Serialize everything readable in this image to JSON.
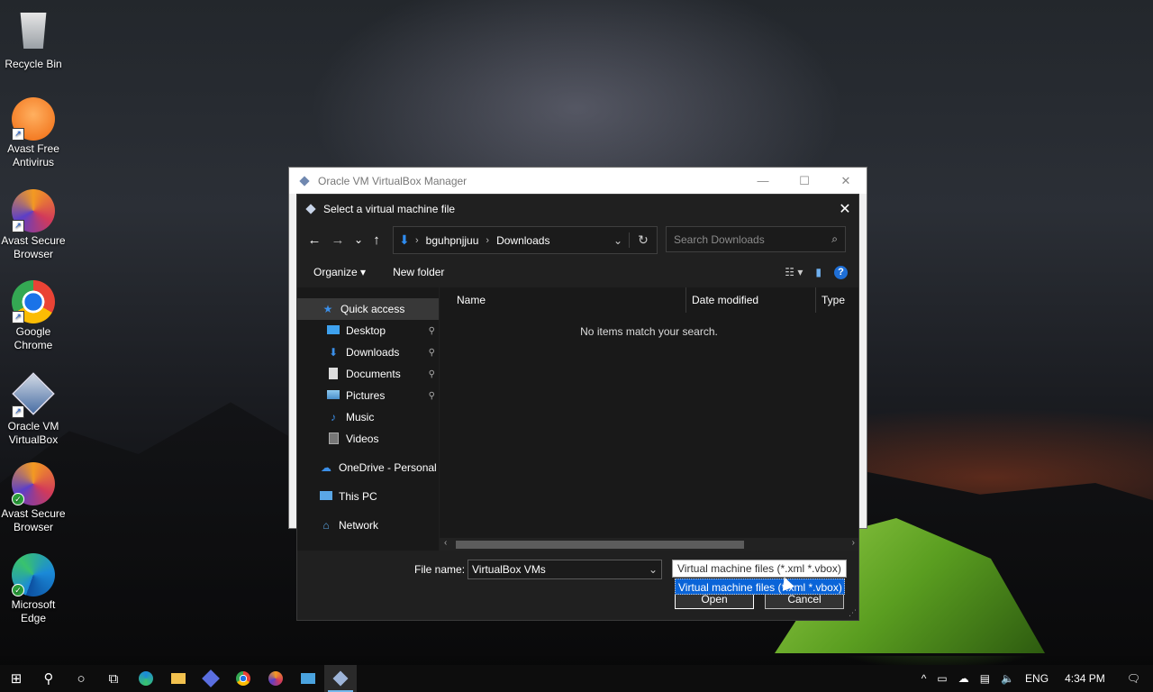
{
  "desktop": {
    "icons": [
      {
        "label": "Recycle Bin"
      },
      {
        "label": "Avast Free Antivirus"
      },
      {
        "label": "Avast Secure Browser"
      },
      {
        "label": "Google Chrome"
      },
      {
        "label": "Oracle VM VirtualBox"
      },
      {
        "label": "Avast Secure Browser"
      },
      {
        "label": "Microsoft Edge"
      }
    ]
  },
  "background_window": {
    "title": "Oracle VM VirtualBox Manager",
    "minimize": "—",
    "maximize": "☐",
    "close": "✕"
  },
  "dialog": {
    "title": "Select a virtual machine file",
    "close": "✕",
    "nav": {
      "back": "←",
      "forward": "→",
      "recent": "⌄",
      "up": "↑",
      "breadcrumb": [
        "bguhpnjjuu",
        "Downloads"
      ],
      "breadcrumb_sep": "›",
      "address_dropdown": "⌄",
      "refresh": "↻"
    },
    "search": {
      "placeholder": "Search Downloads",
      "icon": "⌕"
    },
    "toolbar": {
      "organize": "Organize ▾",
      "new_folder": "New folder",
      "view_icon": "☷ ▾",
      "preview_icon": "▮",
      "help": "?"
    },
    "nav_pane": {
      "quick_access": "Quick access",
      "pinned": [
        {
          "label": "Desktop",
          "pin": "📌"
        },
        {
          "label": "Downloads",
          "pin": "📌"
        },
        {
          "label": "Documents",
          "pin": "📌"
        },
        {
          "label": "Pictures",
          "pin": "📌"
        }
      ],
      "other": [
        {
          "label": "Music"
        },
        {
          "label": "Videos"
        }
      ],
      "onedrive": "OneDrive - Personal",
      "this_pc": "This PC",
      "network": "Network"
    },
    "file_pane": {
      "columns": [
        "Name",
        "Date modified",
        "Type"
      ],
      "empty_message": "No items match your search."
    },
    "file_name_label": "File name:",
    "file_name_value": "VirtualBox VMs",
    "file_type_selected": "Virtual machine files (*.xml *.vbox)",
    "file_type_option": "Virtual machine files (*.xml *.vbox)",
    "open_button": "Open",
    "cancel_button": "Cancel"
  },
  "taskbar": {
    "start": "⊞",
    "search": "⚲",
    "cortana": "○",
    "task_view": "⧉",
    "apps": [
      "Edge",
      "File Explorer",
      "App",
      "Chrome",
      "Avast Secure Browser",
      "Control Panel",
      "VirtualBox"
    ],
    "tray": {
      "chevron": "^",
      "language": "ENG",
      "time": "4:34 PM",
      "notifications": "🗨"
    }
  },
  "colors": {
    "dialog_bg": "#202020",
    "selection": "#0a64d8",
    "accent": "#2f8cf0"
  }
}
